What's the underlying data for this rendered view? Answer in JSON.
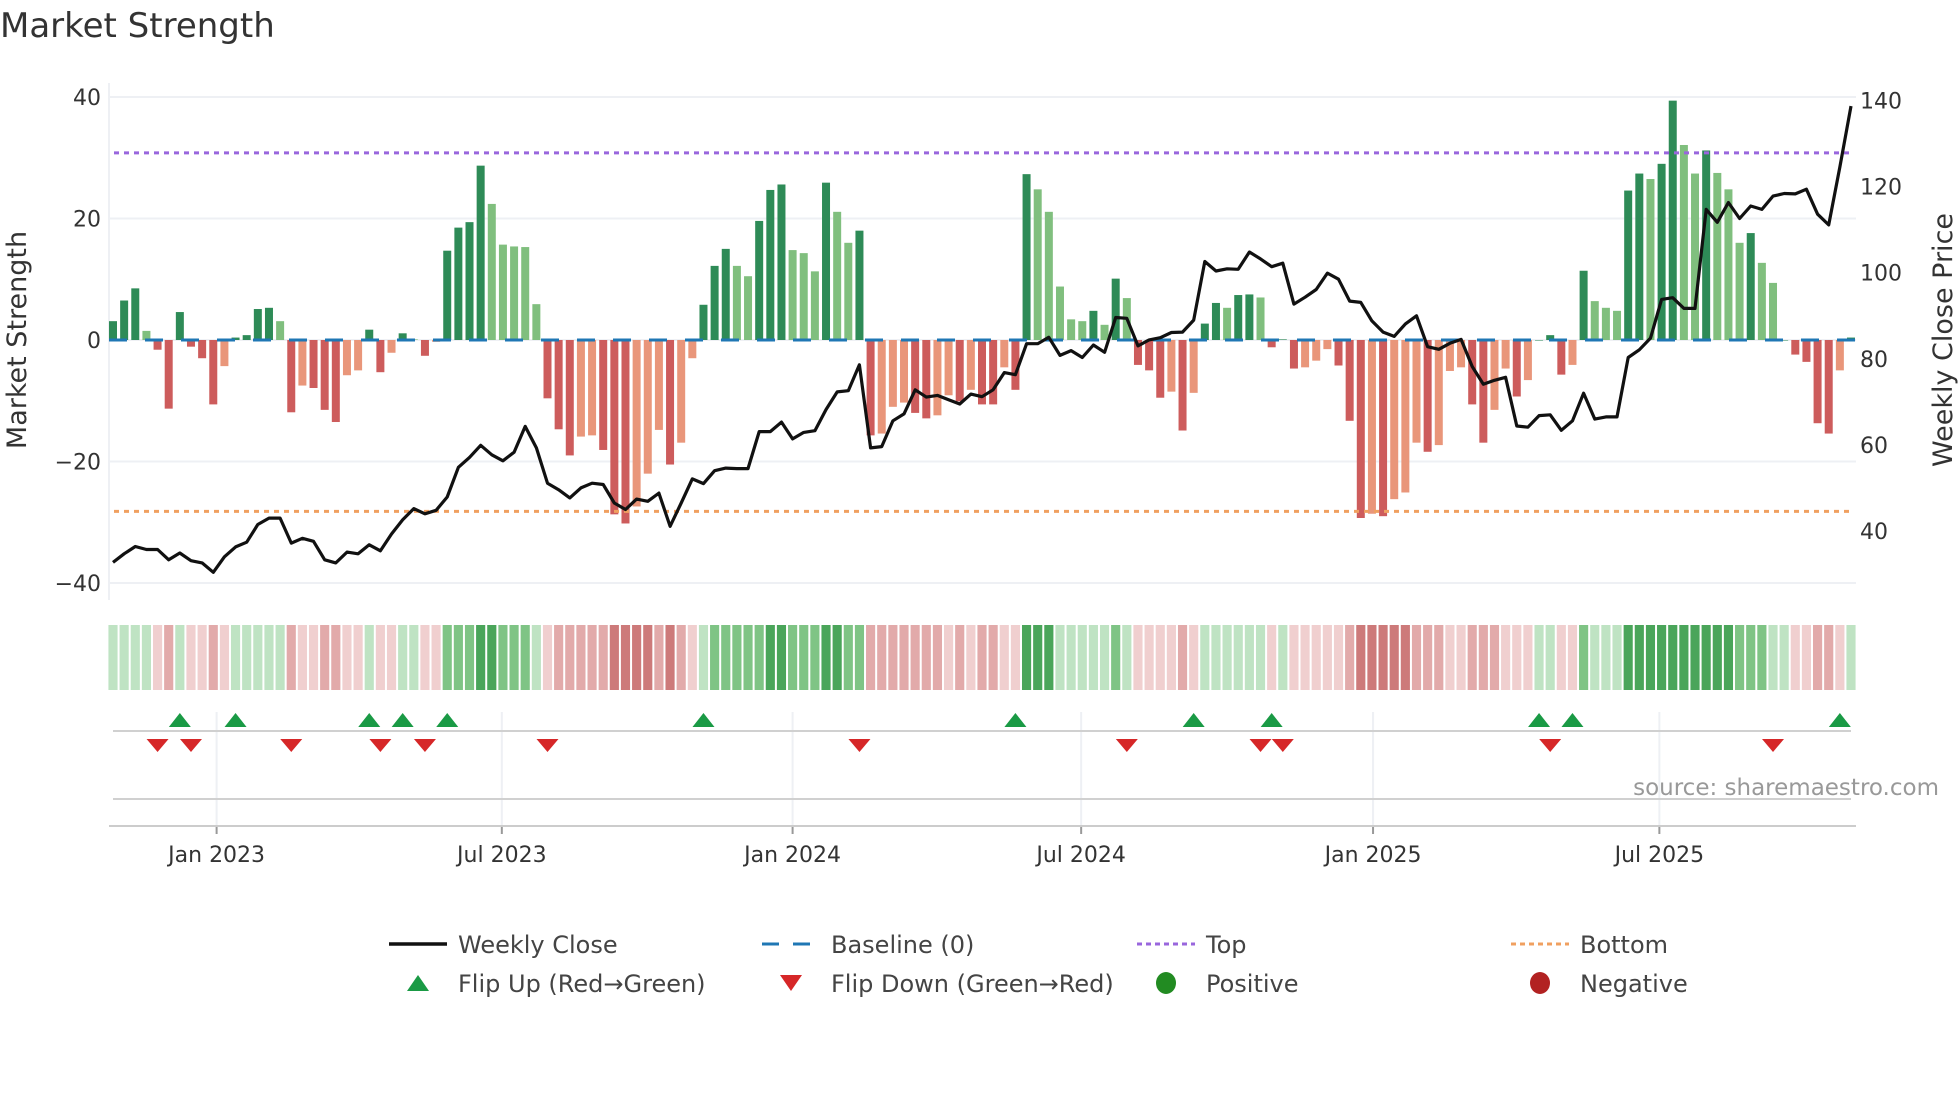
{
  "chart_data": {
    "type": "bar",
    "title": "Market Strength",
    "ylabel": "Market Strength",
    "y2label": "Weekly Close Price",
    "ylim": [
      -40,
      40
    ],
    "y2lim": [
      40,
      140
    ],
    "yticks": [
      "40",
      "20",
      "0",
      "−20",
      "−40"
    ],
    "ytick_values": [
      40,
      20,
      0,
      -20,
      -40
    ],
    "y2ticks": [
      "140",
      "120",
      "100",
      "80",
      "60",
      "40"
    ],
    "y2tick_values": [
      140,
      120,
      100,
      80,
      60,
      40
    ],
    "x_unit": "week index",
    "xticks": [
      {
        "label": "Jan 2023",
        "at": 9.3
      },
      {
        "label": "Jul 2023",
        "at": 34.9
      },
      {
        "label": "Jan 2024",
        "at": 61.0
      },
      {
        "label": "Jul 2024",
        "at": 86.9
      },
      {
        "label": "Jan 2025",
        "at": 113.1
      },
      {
        "label": "Jul 2025",
        "at": 138.8
      }
    ],
    "top_level": 30.8,
    "bottom_level": -28.2,
    "baseline": 0,
    "strength": [
      3.1,
      6.5,
      8.5,
      1.5,
      -1.6,
      -11.3,
      4.6,
      -1.1,
      -3.0,
      -10.6,
      -4.3,
      0.4,
      0.8,
      5.1,
      5.3,
      3.1,
      -11.9,
      -7.5,
      -7.9,
      -11.5,
      -13.5,
      -5.8,
      -5.0,
      1.7,
      -5.3,
      -2.1,
      1.1,
      0.1,
      -2.6,
      -0.3,
      14.7,
      18.5,
      19.4,
      28.7,
      22.4,
      15.7,
      15.4,
      15.3,
      5.9,
      -9.6,
      -14.7,
      -19.0,
      -15.9,
      -15.7,
      -18.1,
      -28.7,
      -30.2,
      -27.4,
      -22.0,
      -14.8,
      -20.5,
      -16.9,
      -3.0,
      5.8,
      12.2,
      15.0,
      12.2,
      10.5,
      19.6,
      24.7,
      25.6,
      14.8,
      14.3,
      11.3,
      25.9,
      21.1,
      16.0,
      18.0,
      -15.7,
      -15.4,
      -11.0,
      -10.3,
      -12.0,
      -12.9,
      -12.4,
      -9.1,
      -10.1,
      -8.2,
      -10.6,
      -10.6,
      -4.5,
      -8.2,
      27.3,
      24.8,
      21.1,
      8.8,
      3.4,
      3.1,
      4.8,
      2.5,
      10.1,
      6.9,
      -4.1,
      -5.0,
      -9.5,
      -8.5,
      -14.9,
      -8.7,
      2.7,
      6.1,
      5.3,
      7.4,
      7.5,
      7.0,
      -1.2,
      0.1,
      -4.7,
      -4.5,
      -3.4,
      -1.5,
      -4.2,
      -13.3,
      -29.3,
      -28.6,
      -29.0,
      -26.2,
      -25.1,
      -16.9,
      -18.4,
      -17.3,
      -5.1,
      -4.5,
      -10.6,
      -16.9,
      -11.5,
      -4.7,
      -9.3,
      -6.6,
      0.0,
      0.8,
      -5.7,
      -4.1,
      11.4,
      6.4,
      5.3,
      4.8,
      24.6,
      27.4,
      26.5,
      29.0,
      39.4,
      32.1,
      27.4,
      31.2,
      27.5,
      24.8,
      16.0,
      17.6,
      12.7,
      9.4,
      0.0,
      -2.4,
      -3.6,
      -13.7,
      -15.4,
      -5.0,
      0.4
    ],
    "weekly_close": [
      32.7,
      34.7,
      36.4,
      35.7,
      35.7,
      33.3,
      34.9,
      33.1,
      32.6,
      30.4,
      34.0,
      36.3,
      37.4,
      41.5,
      43.0,
      43.0,
      37.2,
      38.3,
      37.6,
      33.3,
      32.6,
      35.1,
      34.7,
      36.8,
      35.4,
      39.3,
      42.6,
      45.2,
      44.0,
      44.8,
      47.9,
      54.8,
      57.1,
      59.9,
      57.7,
      56.3,
      58.3,
      64.3,
      59.3,
      51.1,
      49.6,
      47.7,
      50.0,
      51.1,
      50.8,
      46.5,
      45.0,
      47.4,
      46.9,
      48.8,
      41.1,
      46.5,
      52.1,
      51.0,
      54.0,
      54.6,
      54.5,
      54.5,
      63.1,
      63.1,
      65.3,
      61.4,
      62.9,
      63.3,
      68.2,
      72.3,
      72.6,
      78.6,
      59.3,
      59.6,
      65.6,
      67.2,
      72.8,
      71.1,
      71.5,
      70.5,
      69.5,
      71.8,
      71.2,
      72.8,
      76.8,
      76.3,
      83.5,
      83.5,
      85.0,
      80.8,
      81.9,
      80.3,
      83.2,
      81.5,
      89.6,
      89.4,
      83.0,
      84.4,
      84.9,
      86.1,
      86.2,
      89.0,
      102.6,
      100.4,
      100.9,
      100.8,
      104.8,
      103.2,
      101.4,
      102.2,
      92.7,
      94.3,
      96.1,
      99.9,
      98.5,
      93.4,
      93.1,
      88.8,
      86.2,
      85.2,
      88.1,
      90.0,
      82.8,
      82.2,
      83.6,
      84.5,
      78.2,
      74.1,
      75.0,
      75.7,
      64.4,
      64.1,
      66.8,
      67.0,
      63.4,
      65.6,
      72.0,
      66.0,
      66.5,
      66.5,
      80.3,
      82.1,
      84.8,
      93.8,
      94.2,
      91.7,
      91.7,
      114.7,
      111.7,
      116.3,
      112.6,
      115.5,
      114.7,
      117.8,
      118.4,
      118.3,
      119.4,
      113.6,
      111.1,
      124.6,
      138.7
    ],
    "flip_up_weeks": [
      6,
      11,
      23,
      26,
      30,
      53,
      81,
      97,
      104,
      128,
      131,
      155
    ],
    "flip_down_weeks": [
      4,
      7,
      16,
      24,
      28,
      39,
      67,
      91,
      103,
      105,
      129,
      149
    ],
    "legend": {
      "placement": "bottom",
      "items": [
        {
          "label": "Weekly Close",
          "symbol": "line"
        },
        {
          "label": "Baseline (0)",
          "symbol": "dash"
        },
        {
          "label": "Top",
          "symbol": "dot"
        },
        {
          "label": "Bottom",
          "symbol": "dot"
        },
        {
          "label": "Flip Up (Red→Green)",
          "symbol": "triangle-up"
        },
        {
          "label": "Flip Down (Green→Red)",
          "symbol": "triangle-down"
        },
        {
          "label": "Positive",
          "symbol": "circle"
        },
        {
          "label": "Negative",
          "symbol": "circle"
        }
      ]
    },
    "source": "source: sharemaestro.com"
  },
  "colors": {
    "pos_strong": "#2e8b57",
    "pos_weak": "#80bf7e",
    "neg_strong": "#cd5c5c",
    "neg_weak": "#e9967a",
    "line": "#111111",
    "baseline": "#1f77b4",
    "top": "#9966dd",
    "bottom": "#f0a060",
    "flip_up": "#1a9a45",
    "flip_down": "#d62728",
    "positive": "#228b22",
    "negative": "#b22222",
    "grid": "#eef0f4"
  }
}
